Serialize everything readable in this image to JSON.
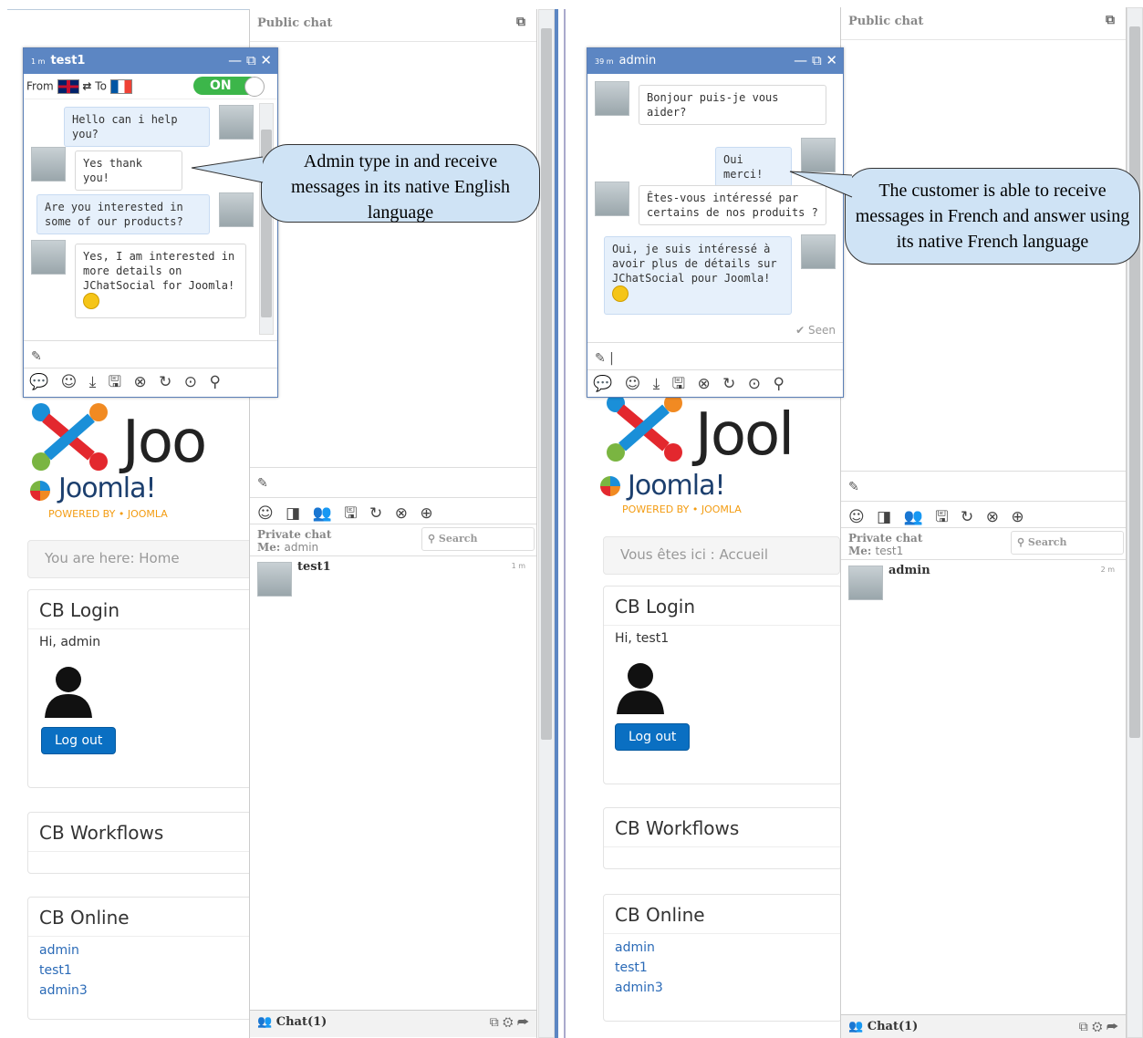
{
  "left": {
    "breadcrumb": "You are here:   Home",
    "cb_login": {
      "title": "CB Login",
      "greeting": "Hi, admin",
      "logout": "Log out"
    },
    "cb_workflows": {
      "title": "CB Workflows"
    },
    "cb_online": {
      "title": "CB Online",
      "users": [
        "admin",
        "test1",
        "admin3"
      ]
    },
    "public_chat": {
      "title": "Public chat"
    },
    "private_chat": {
      "title": "Private chat",
      "me_label": "Me:",
      "me": "admin",
      "search": "Search",
      "user": "test1",
      "user_time": "1 m"
    },
    "bottom_bar": {
      "label": "Chat(1)"
    },
    "chat_window": {
      "time": "1 m",
      "user": "test1",
      "from_label": "From",
      "to_label": "To",
      "toggle": "ON",
      "messages": [
        {
          "side": "right",
          "text": "Hello can i help you?"
        },
        {
          "side": "left",
          "text": "Yes thank you!"
        },
        {
          "side": "right",
          "text": "Are you interested in some of our products?"
        },
        {
          "side": "left",
          "text": "Yes, I am interested in more details on JChatSocial for Joomla!"
        }
      ]
    },
    "callout": "Admin type in and receive messages in its native English language"
  },
  "right": {
    "breadcrumb": "Vous êtes ici :   Accueil",
    "cb_login": {
      "title": "CB Login",
      "greeting": "Hi, test1",
      "logout": "Log out"
    },
    "cb_workflows": {
      "title": "CB Workflows"
    },
    "cb_online": {
      "title": "CB Online",
      "users": [
        "admin",
        "test1",
        "admin3"
      ]
    },
    "public_chat": {
      "title": "Public chat"
    },
    "private_chat": {
      "title": "Private chat",
      "me_label": "Me:",
      "me": "test1",
      "search": "Search",
      "user": "admin",
      "user_time": "2 m"
    },
    "bottom_bar": {
      "label": "Chat(1)"
    },
    "chat_window": {
      "time": "39 m",
      "user": "admin",
      "seen": "✔ Seen",
      "messages": [
        {
          "side": "left",
          "text": "Bonjour puis-je vous aider?"
        },
        {
          "side": "right",
          "text": "Oui merci!"
        },
        {
          "side": "left",
          "text": "Êtes-vous intéressé par certains de nos produits ?"
        },
        {
          "side": "right",
          "text": "Oui, je suis intéressé à avoir plus de détails sur JChatSocial pour Joomla!"
        }
      ]
    },
    "callout": "The customer is able to receive messages in French and answer using its native French language"
  },
  "brand": {
    "joomla_big": "Joo",
    "joomla_big_right": "Jool",
    "joomla_small": "Joomla!",
    "powered": "POWERED BY • JOOMLA"
  },
  "icons": {
    "chat_toolbar": "💬 ☺ ⤓ 🖫 ⊗ ↻ ⊙ ⚲",
    "panel_toolbar": "☺ ◨ 👥 🖫 ↻ ⊗ ⊕"
  },
  "colors": {
    "accent": "#5c86c3",
    "button": "#0a6fc2",
    "callout": "#cfe3f5",
    "toggle": "#3cb64a"
  }
}
